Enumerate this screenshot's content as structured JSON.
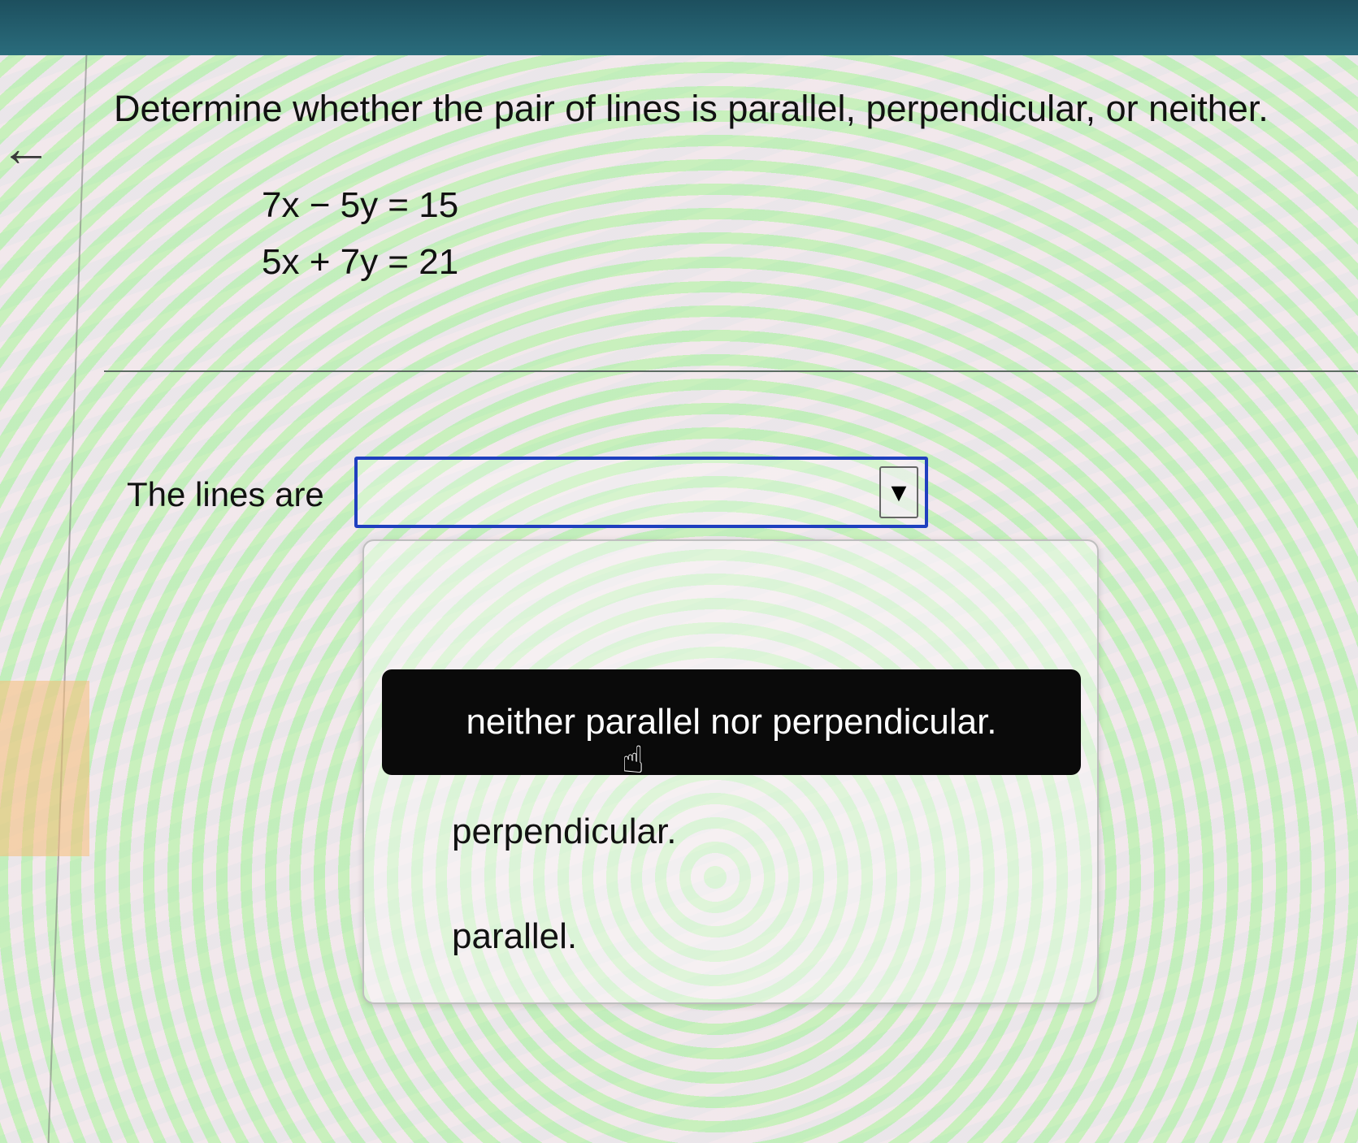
{
  "question": {
    "text": "Determine whether the pair of lines is parallel, perpendicular, or neither.",
    "equations": [
      "7x − 5y = 15",
      "5x + 7y = 21"
    ]
  },
  "answer": {
    "prompt": "The lines are",
    "selected_value": "",
    "options": [
      "neither parallel nor perpendicular.",
      "perpendicular.",
      "parallel."
    ],
    "highlighted_option": "neither parallel nor perpendicular."
  },
  "colors": {
    "select_border": "#1f3fbf",
    "highlight_bg": "#0a0a0a",
    "top_bar": "#1d4f5e"
  },
  "icons": {
    "back": "arrow-left-icon",
    "dropdown": "triangle-down-icon",
    "cursor": "hand-pointer-icon"
  }
}
